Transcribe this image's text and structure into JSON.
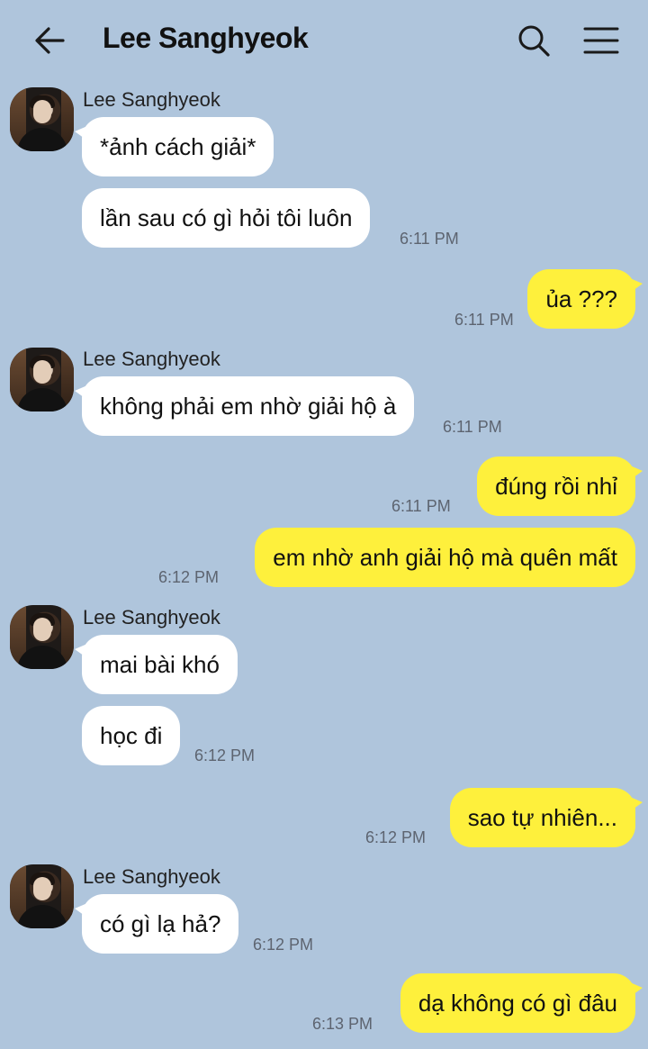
{
  "header": {
    "title": "Lee Sanghyeok",
    "back_icon": "arrow-left-icon",
    "search_icon": "search-icon",
    "menu_icon": "hamburger-menu-icon"
  },
  "colors": {
    "background": "#afc5dc",
    "incoming_bubble": "#ffffff",
    "outgoing_bubble": "#fef03c"
  },
  "messages": [
    {
      "sender": "Lee Sanghyeok",
      "text": "*ảnh cách giải*",
      "time": ""
    },
    {
      "sender": "",
      "text": "lần sau có gì hỏi tôi luôn",
      "time": "6:11 PM"
    },
    {
      "sender": "",
      "text": "ủa ???",
      "time": "6:11 PM"
    },
    {
      "sender": "Lee Sanghyeok",
      "text": "không phải em nhờ giải hộ à",
      "time": "6:11 PM"
    },
    {
      "sender": "",
      "text": "đúng rồi nhỉ",
      "time": "6:11 PM"
    },
    {
      "sender": "",
      "text": "em nhờ anh giải hộ mà quên mất",
      "time": "6:12 PM"
    },
    {
      "sender": "Lee Sanghyeok",
      "text": "mai bài khó",
      "time": ""
    },
    {
      "sender": "",
      "text": "học đi",
      "time": "6:12 PM"
    },
    {
      "sender": "",
      "text": "sao tự nhiên...",
      "time": "6:12 PM"
    },
    {
      "sender": "Lee Sanghyeok",
      "text": "có gì lạ hả?",
      "time": "6:12 PM"
    },
    {
      "sender": "",
      "text": "dạ không có gì đâu",
      "time": "6:13 PM"
    }
  ]
}
